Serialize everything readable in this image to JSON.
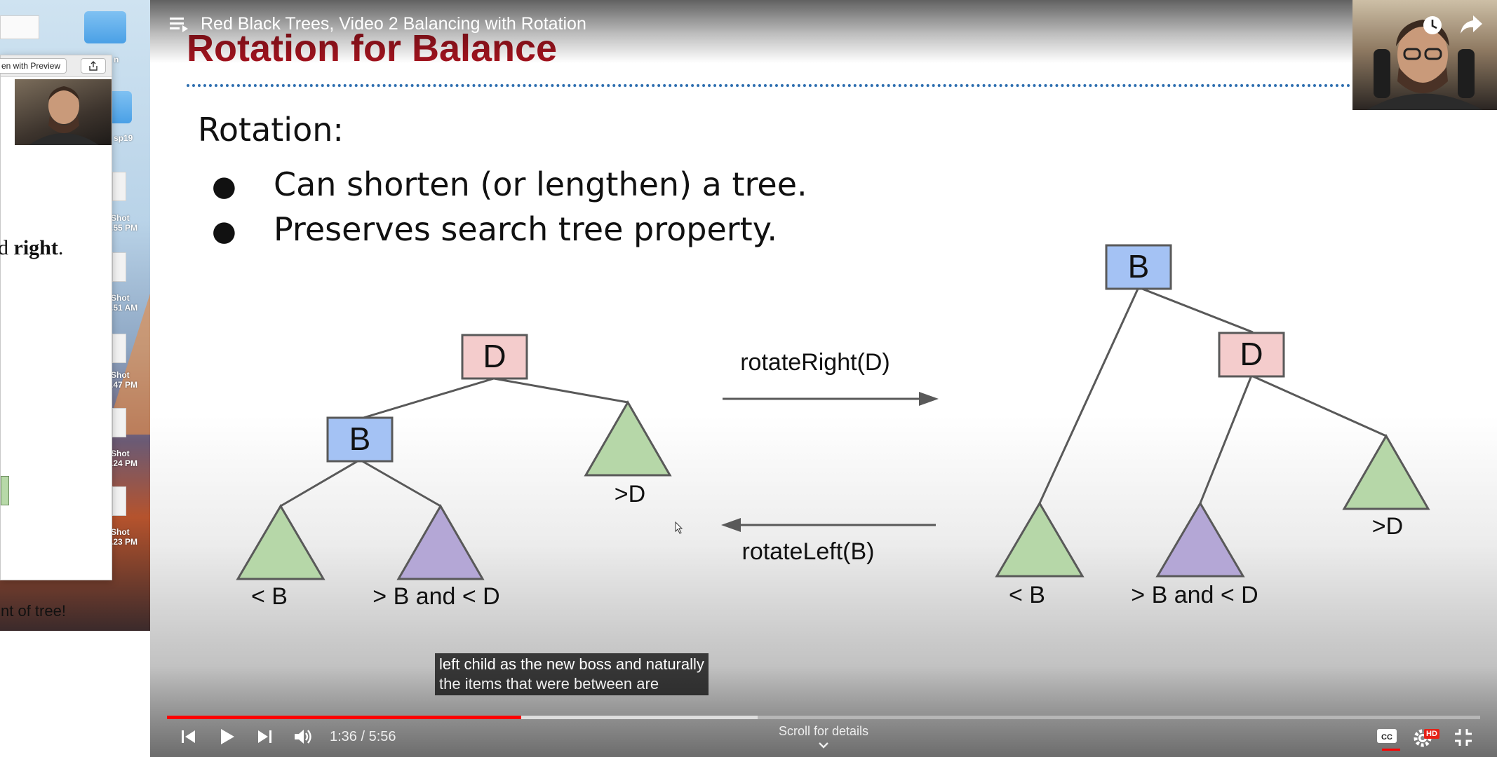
{
  "desktop": {
    "labels": [
      "n",
      "sp19",
      "Shot\n.55 PM",
      "Shot\n.51 AM",
      "Shot\n.47 PM",
      "Shot\n.24 PM",
      "Shot\n.23 PM"
    ]
  },
  "preview_window": {
    "open_with_preview_label": "en with Preview",
    "partial_text_prefix": "d ",
    "partial_text_bold": "right",
    "partial_text_suffix": ".",
    "bottom_text": "nt of tree!"
  },
  "player": {
    "video_title": "Red Black Trees, Video 2 Balancing with Rotation",
    "time_display": "1:36 / 5:56",
    "progress_played": 0.27,
    "progress_buffered": 0.45,
    "scroll_hint": "Scroll for details",
    "hd_badge": "HD",
    "caption_text": "left child as the new boss and naturally\nthe items that were between are"
  },
  "slide": {
    "title": "Rotation for Balance",
    "heading": "Rotation:",
    "bullets": [
      "Can shorten (or lengthen) a tree.",
      "Preserves search tree property."
    ],
    "diagram": {
      "left_tree": {
        "root": "D",
        "child": "B",
        "subtree_labels": [
          "< B",
          "> B and < D",
          ">D"
        ]
      },
      "right_tree": {
        "root": "B",
        "child": "D",
        "subtree_labels": [
          "< B",
          "> B and < D",
          ">D"
        ]
      },
      "rotate_right_label": "rotateRight(D)",
      "rotate_left_label": "rotateLeft(B)"
    }
  },
  "colors": {
    "title_red": "#a3141f",
    "dotted_blue": "#2e6fb0",
    "node_pink": "#f4cccc",
    "node_blue": "#a4c2f4",
    "triangle_green": "#b6d7a8",
    "triangle_purple": "#b4a7d6",
    "progress_red": "#ff0000"
  }
}
